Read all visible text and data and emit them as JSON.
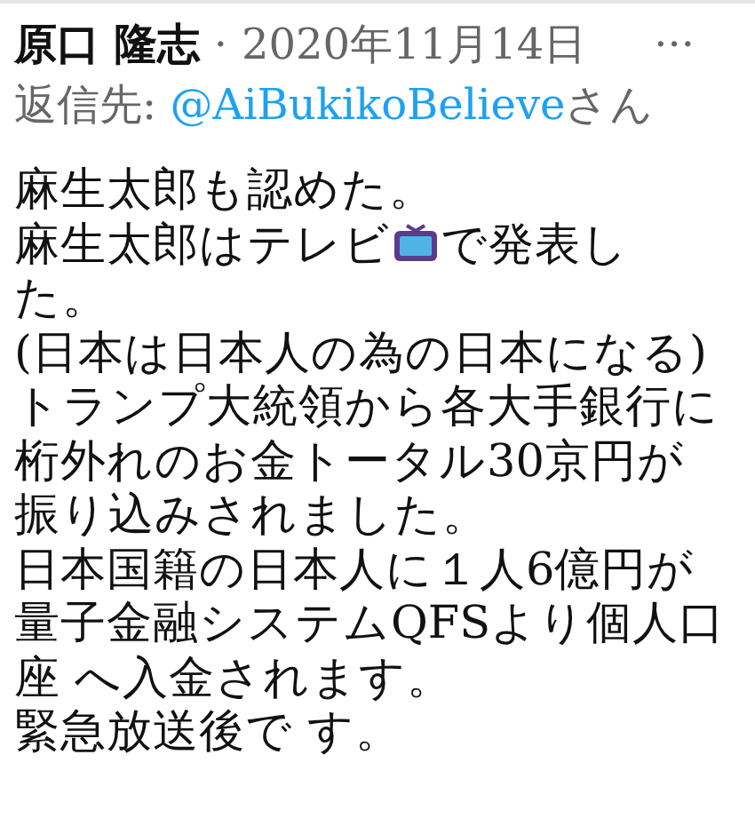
{
  "author": {
    "name": "原口 隆志",
    "separator": "·",
    "date": "2020年11月14日",
    "more": "···"
  },
  "reply_to": {
    "label": "返信先:",
    "handle": "@AiBukikoBelieve",
    "suffix": "さん"
  },
  "body_lines": [
    {
      "parts": [
        "麻生太郎も認めた。"
      ]
    },
    {
      "parts": [
        "麻生太郎はテレビ",
        "で発表し"
      ]
    },
    {
      "parts": [
        "た。"
      ]
    },
    {
      "parts": [
        "(日本は日本人の為の日本になる)"
      ]
    },
    {
      "parts": [
        "トランプ大統領から各大手銀行に"
      ]
    },
    {
      "parts": [
        "桁外れのお金トータル30京円が"
      ]
    },
    {
      "parts": [
        "振り込みされました。"
      ]
    },
    {
      "parts": [
        "日本国籍の日本人に１人6億円が"
      ]
    },
    {
      "parts": [
        "量子金融システムQFSより個人口"
      ]
    },
    {
      "parts": [
        "座 へ入金されます。"
      ]
    },
    {
      "parts": [
        "緊急放送後で す。"
      ]
    }
  ]
}
